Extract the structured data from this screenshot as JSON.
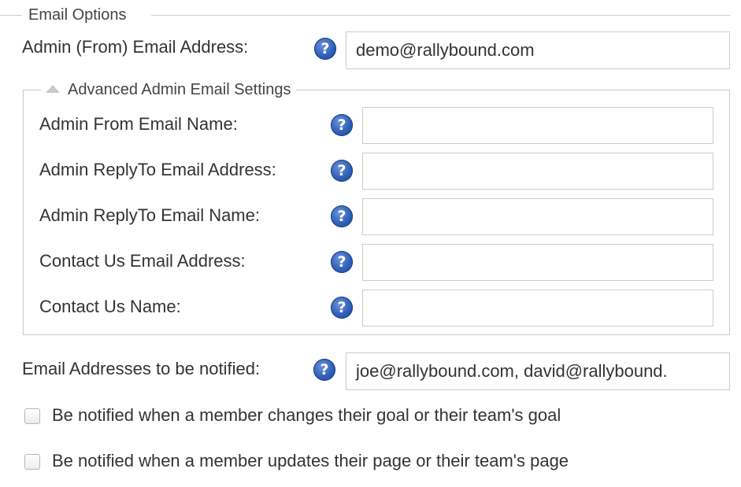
{
  "email_options": {
    "legend": "Email Options",
    "admin_from_email": {
      "label": "Admin (From) Email Address:",
      "value": "demo@rallybound.com"
    },
    "advanced": {
      "legend": "Advanced Admin Email Settings",
      "toggle_icon": "triangle-up-icon",
      "fields": [
        {
          "label": "Admin From Email Name:",
          "value": ""
        },
        {
          "label": "Admin ReplyTo Email Address:",
          "value": ""
        },
        {
          "label": "Admin ReplyTo Email Name:",
          "value": ""
        },
        {
          "label": "Contact Us Email Address:",
          "value": ""
        },
        {
          "label": "Contact Us Name:",
          "value": ""
        }
      ]
    },
    "notify_addresses": {
      "label": "Email Addresses to be notified:",
      "value": "joe@rallybound.com, david@rallybound."
    },
    "checkboxes": [
      {
        "label": "Be notified when a member changes their goal or their team's goal",
        "checked": false
      },
      {
        "label": "Be notified when a member updates their page or their team's page",
        "checked": false
      }
    ],
    "help_glyph": "?"
  },
  "colors": {
    "help_icon": "#2f5fb8",
    "border": "#cccccc",
    "text": "#333333"
  }
}
